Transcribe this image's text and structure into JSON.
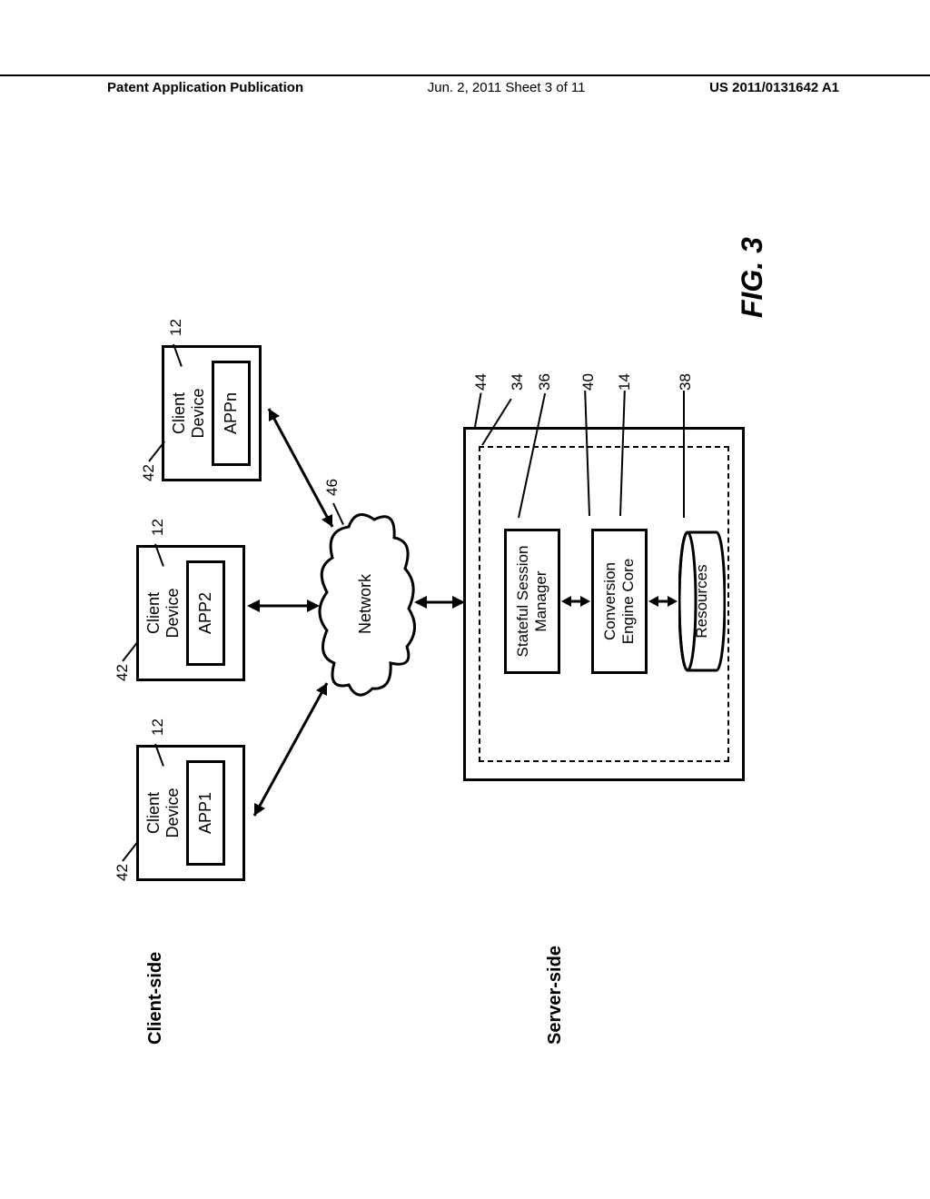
{
  "header": {
    "left": "Patent Application Publication",
    "center": "Jun. 2, 2011  Sheet 3 of 11",
    "right": "US 2011/0131642 A1"
  },
  "figure": {
    "label": "FIG. 3",
    "client_side_label": "Client-side",
    "server_side_label": "Server-side",
    "network_label": "Network",
    "clients": [
      {
        "title": "Client\nDevice",
        "app": "APP1"
      },
      {
        "title": "Client\nDevice",
        "app": "APP2"
      },
      {
        "title": "Client\nDevice",
        "app": "APPn"
      }
    ],
    "server": {
      "ssm": "Stateful Session\nManager",
      "cec": "Conversion\nEngine Core",
      "res": "Resources"
    },
    "refs": {
      "r12a": "12",
      "r12b": "12",
      "r12c": "12",
      "r42a": "42",
      "r42b": "42",
      "r42c": "42",
      "r46": "46",
      "r44": "44",
      "r34": "34",
      "r36": "36",
      "r40": "40",
      "r14": "14",
      "r38": "38"
    }
  }
}
